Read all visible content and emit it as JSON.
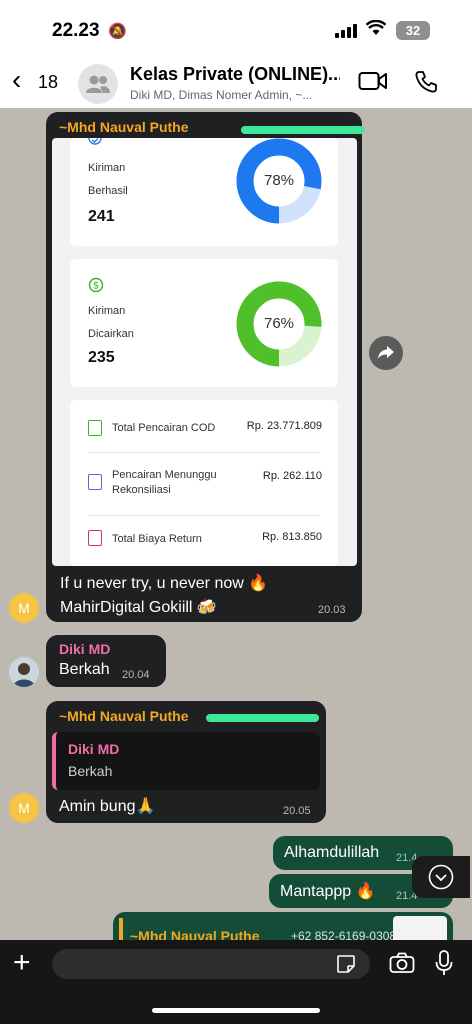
{
  "status": {
    "time": "22.23",
    "battery": "32"
  },
  "header": {
    "back_count": "18",
    "title": "Kelas Private (ONLINE)...",
    "subtitle": "Diki MD, Dimas Nomer Admin, ~..."
  },
  "messages": {
    "m1": {
      "sender": "~Mhd Nauval Puthe",
      "cards": {
        "c1": {
          "label1": "Kiriman",
          "label2": "Berhasil",
          "value": "241",
          "percent": 78,
          "percent_text": "78%",
          "color": "#1e78f0",
          "track": "#cfe1fb"
        },
        "c2": {
          "label1": "Kiriman",
          "label2": "Dicairkan",
          "value": "235",
          "percent": 76,
          "percent_text": "76%",
          "color": "#4fbf2a",
          "track": "#d9f2cf"
        }
      },
      "rows": [
        {
          "label": "Total Pencairan COD",
          "value": "Rp. 23.771.809"
        },
        {
          "label": "Pencairan Menunggu Rekonsiliasi",
          "value": "Rp. 262.110"
        },
        {
          "label": "Total Biaya Return",
          "value": "Rp. 813.850"
        }
      ],
      "text1": "If u never try, u never now 🔥",
      "text2": "MahirDigital Gokiill 🍻",
      "time": "20.03"
    },
    "m2": {
      "sender": "Diki MD",
      "text": "Berkah",
      "time": "20.04"
    },
    "m3": {
      "sender": "~Mhd Nauval Puthe",
      "quote_sender": "Diki MD",
      "quote_text": "Berkah",
      "text": "Amin bung🙏",
      "time": "20.05"
    },
    "m4": {
      "text": "Alhamdulillah",
      "time": "21.4"
    },
    "m5": {
      "text": "Mantappp 🔥",
      "time": "21.4"
    },
    "m6": {
      "sender": "~Mhd Nauval Puthe",
      "phone": "+62 852-6169-0308"
    }
  },
  "avatars": {
    "m_letter": "M"
  }
}
